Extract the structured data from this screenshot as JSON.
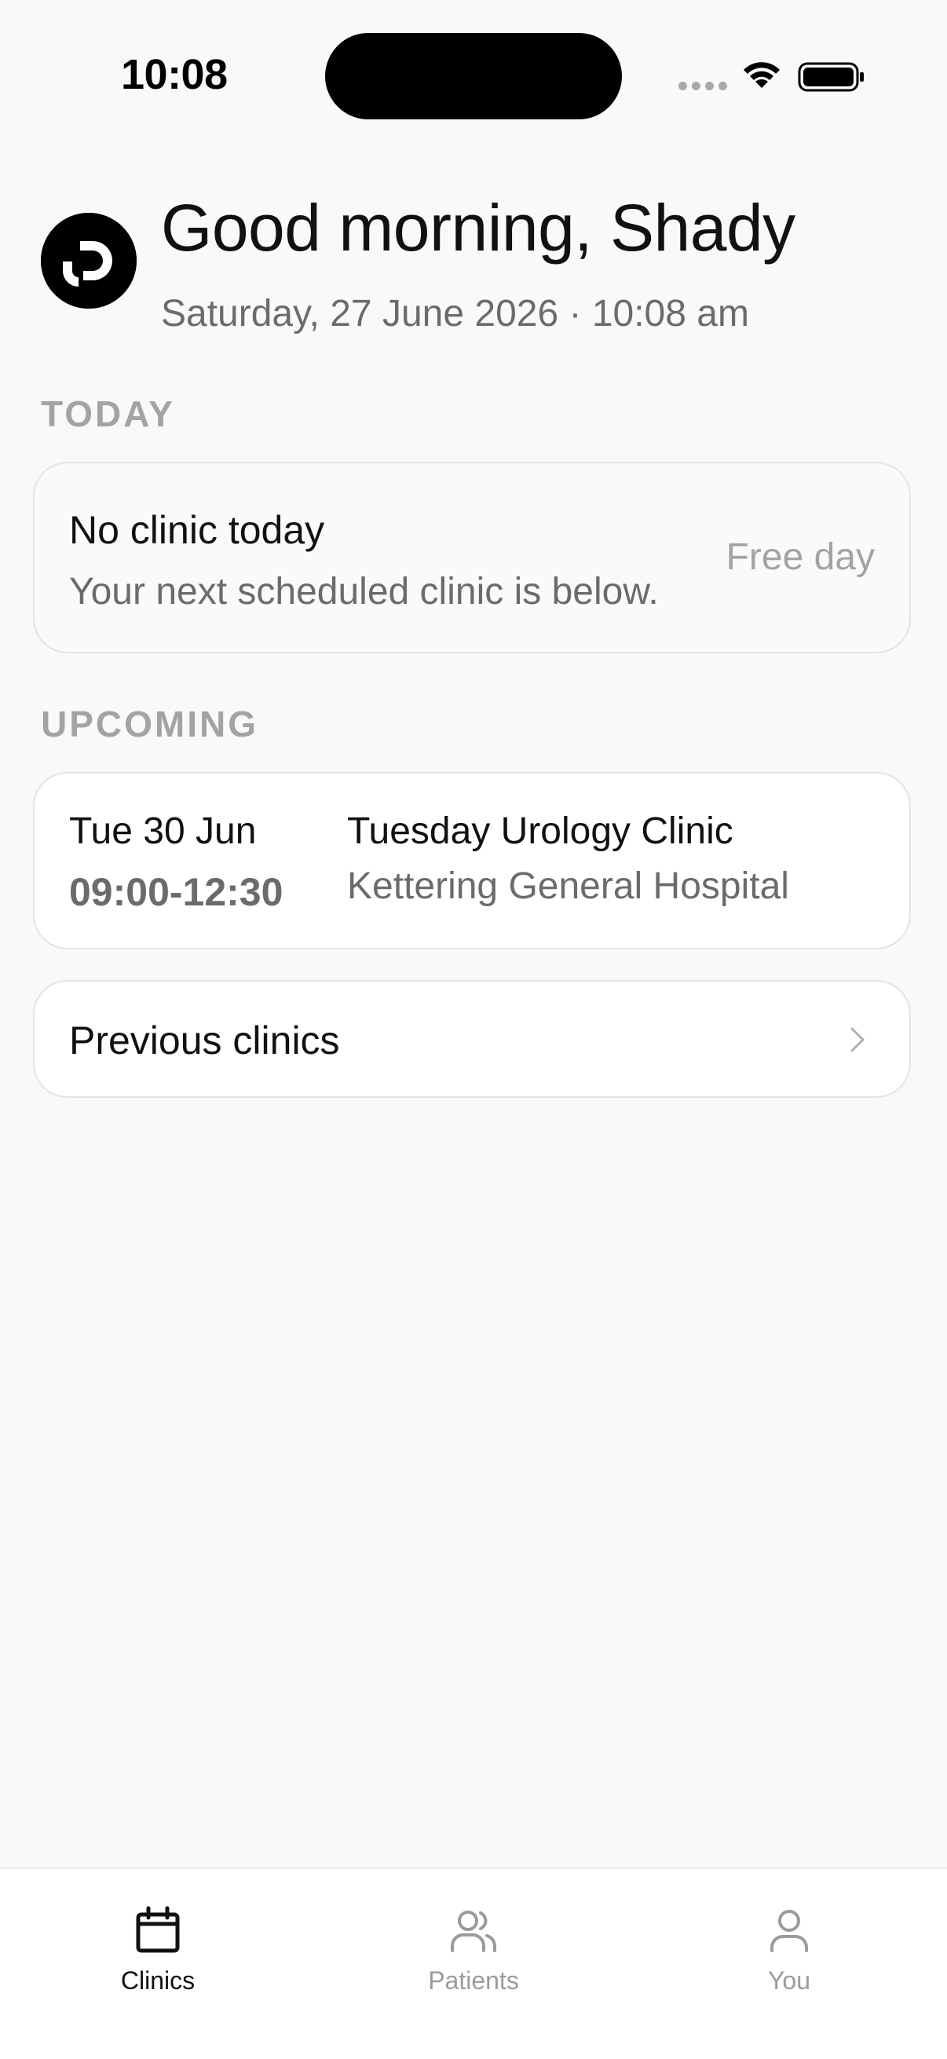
{
  "status_bar": {
    "time": "10:08"
  },
  "header": {
    "greeting": "Good morning, Shady",
    "date_line": "Saturday, 27 June 2026 · 10:08 am"
  },
  "sections": {
    "today_label": "TODAY",
    "upcoming_label": "UPCOMING"
  },
  "today_card": {
    "title": "No clinic today",
    "subtitle": "Your next scheduled clinic is below.",
    "badge": "Free day"
  },
  "upcoming": [
    {
      "date": "Tue 30 Jun",
      "time": "09:00-12:30",
      "title": "Tuesday Urology Clinic",
      "location": "Kettering General Hospital"
    }
  ],
  "previous_clinics": {
    "label": "Previous clinics"
  },
  "tab_bar": {
    "tabs": [
      {
        "label": "Clinics",
        "icon": "calendar-icon",
        "active": true
      },
      {
        "label": "Patients",
        "icon": "users-icon",
        "active": false
      },
      {
        "label": "You",
        "icon": "user-icon",
        "active": false
      }
    ]
  },
  "colors": {
    "background": "#f9f9f9",
    "text_primary": "#111111",
    "text_secondary": "#6b6b6b",
    "text_muted": "#a3a3a3",
    "card_border": "#e4e4e4"
  }
}
